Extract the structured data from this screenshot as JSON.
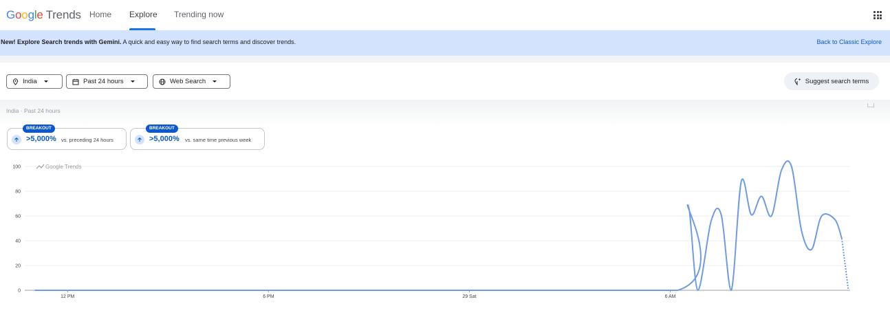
{
  "header": {
    "logo_google": [
      "G",
      "o",
      "o",
      "g",
      "l",
      "e"
    ],
    "logo_trends": "Trends",
    "tabs": [
      {
        "label": "Home",
        "active": false
      },
      {
        "label": "Explore",
        "active": true
      },
      {
        "label": "Trending now",
        "active": false
      }
    ],
    "apps_icon": "apps-grid-icon"
  },
  "banner": {
    "bold": "New! Explore Search trends with Gemini.",
    "text": " A quick and easy way to find search terms and discover trends.",
    "link": "Back to Classic Explore"
  },
  "filters": {
    "location": {
      "label": "India",
      "icon": "location-pin-icon"
    },
    "time": {
      "label": "Past 24 hours",
      "icon": "calendar-icon"
    },
    "property": {
      "label": "Web Search",
      "icon": "globe-icon"
    },
    "suggest": {
      "label": "Suggest search terms",
      "icon": "sparkle-icon"
    }
  },
  "breadcrumb": {
    "location": "India",
    "separator": "·",
    "time": "Past 24 hours"
  },
  "stats": [
    {
      "badge": "BREAKOUT",
      "value": ">5,000%",
      "desc": "vs. preceding 24 hours"
    },
    {
      "badge": "BREAKOUT",
      "value": ">5,000%",
      "desc": "vs. same time previous week"
    }
  ],
  "colors": {
    "accent": "#0b57d0",
    "line": "#6f9be6",
    "banner_bg": "#d3e3fd"
  },
  "chart_data": {
    "type": "line",
    "watermark": "Google Trends",
    "ylim": [
      0,
      100
    ],
    "yticks": [
      0,
      20,
      40,
      60,
      80,
      100
    ],
    "xticks": [
      "12 PM",
      "6 PM",
      "29 Sat",
      "6 AM"
    ],
    "series": [
      {
        "points": [
          [
            "-1.0h",
            0
          ],
          [
            "10h",
            0
          ],
          [
            "18.2h",
            0
          ],
          [
            "18.5h",
            69
          ],
          [
            "18.8h",
            0
          ],
          [
            "19.2h",
            56
          ],
          [
            "19.5h",
            61
          ],
          [
            "19.8h",
            0
          ],
          [
            "20.1h",
            88
          ],
          [
            "20.4h",
            61
          ],
          [
            "20.7h",
            76
          ],
          [
            "21.0h",
            60
          ],
          [
            "21.3h",
            97
          ],
          [
            "21.6h",
            100
          ],
          [
            "21.9h",
            48
          ],
          [
            "22.2h",
            33
          ],
          [
            "22.5h",
            60
          ],
          [
            "22.9h",
            57
          ],
          [
            "23.1h",
            42
          ]
        ],
        "partial_tail": [
          [
            "23.1h",
            42
          ],
          [
            "23.3h",
            0
          ]
        ]
      }
    ]
  }
}
